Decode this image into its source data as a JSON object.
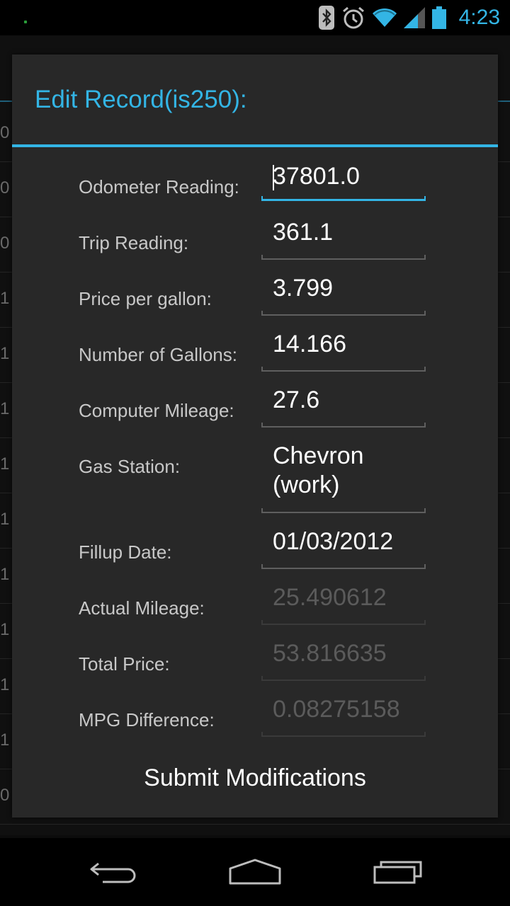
{
  "status_bar": {
    "time": "4:23",
    "icons": [
      "bluetooth-icon",
      "alarm-icon",
      "wifi-icon",
      "signal-icon",
      "battery-icon"
    ],
    "accent": "#33b5e5"
  },
  "background": {
    "row_values": [
      "0",
      "0",
      "0",
      "1",
      "1",
      "1",
      "1",
      "1",
      "1",
      "1",
      "1",
      "1",
      "0"
    ]
  },
  "dialog": {
    "title": "Edit Record(is250):",
    "fields": [
      {
        "label": "Odometer Reading:",
        "value": "37801.0",
        "state": "focused"
      },
      {
        "label": "Trip Reading:",
        "value": "361.1",
        "state": "normal"
      },
      {
        "label": "Price per gallon:",
        "value": "3.799",
        "state": "normal"
      },
      {
        "label": "Number of Gallons:",
        "value": "14.166",
        "state": "normal"
      },
      {
        "label": "Computer Mileage:",
        "value": "27.6",
        "state": "normal"
      },
      {
        "label": "Gas Station:",
        "value_line1": "Chevron",
        "value_line2": "(work)",
        "state": "normal"
      },
      {
        "label": "Fillup Date:",
        "value": "01/03/2012",
        "state": "normal"
      },
      {
        "label": "Actual Mileage:",
        "value": "25.490612",
        "state": "disabled"
      },
      {
        "label": "Total Price:",
        "value": "53.816635",
        "state": "disabled"
      },
      {
        "label": "MPG Difference:",
        "value": "0.08275158",
        "state": "disabled"
      }
    ],
    "submit_label": "Submit Modifications"
  },
  "nav_bar": {
    "buttons": [
      "back-icon",
      "home-icon",
      "recent-apps-icon"
    ]
  }
}
